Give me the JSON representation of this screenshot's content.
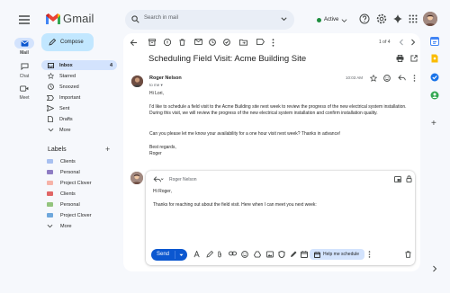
{
  "app": {
    "name": "Gmail"
  },
  "search": {
    "placeholder": "Search in mail"
  },
  "status": {
    "label": "Active"
  },
  "rail": [
    {
      "label": "Mail",
      "icon": "mail-icon"
    },
    {
      "label": "Chat",
      "icon": "chat-icon"
    },
    {
      "label": "Meet",
      "icon": "video-icon"
    }
  ],
  "compose": {
    "label": "Compose"
  },
  "nav": [
    {
      "label": "Inbox",
      "icon": "inbox-icon",
      "count": "4",
      "selected": true
    },
    {
      "label": "Starred",
      "icon": "star-icon",
      "count": ""
    },
    {
      "label": "Snoozed",
      "icon": "clock-icon",
      "count": ""
    },
    {
      "label": "Important",
      "icon": "label-important-icon",
      "count": ""
    },
    {
      "label": "Sent",
      "icon": "send-icon",
      "count": ""
    },
    {
      "label": "Drafts",
      "icon": "draft-icon",
      "count": ""
    },
    {
      "label": "More",
      "icon": "chevron-down-icon",
      "count": ""
    }
  ],
  "labels": {
    "heading": "Labels",
    "items": [
      {
        "label": "Clients",
        "color": "#a8c0f0"
      },
      {
        "label": "Personal",
        "color": "#8e7cc3"
      },
      {
        "label": "Project Clover",
        "color": "#f6b3a8"
      },
      {
        "label": "Clients",
        "color": "#e06666"
      },
      {
        "label": "Personal",
        "color": "#93c47d"
      },
      {
        "label": "Project Clover",
        "color": "#6fa8dc"
      },
      {
        "label": "More",
        "color": ""
      }
    ]
  },
  "pager": {
    "text": "1 of 4"
  },
  "email": {
    "subject": "Scheduling Field Visit: Acme Building Site",
    "sender": "Roger Nelson",
    "to": "to me",
    "time": "10:03 AM",
    "body": [
      "Hi Lori,",
      "I'd like to schedule a field visit to the Acme Building site next week to review the progress of the new electrical system installation. During this visit, we will review the progress of the new electrical system installation and confirm installation quality.",
      "Can you please let me know your availability for a one hour visit next week? Thanks in advance!",
      "Best regards,",
      "Roger"
    ]
  },
  "reply": {
    "to": "Roger Nelson",
    "greeting": "Hi Roger,",
    "text": "Thanks for reaching out about the field visit. Here when I can meet you next week:",
    "send_label": "Send",
    "help_label": "Help me schedule"
  },
  "colors": {
    "accent": "#0b57d0",
    "compose": "#c2e7ff",
    "selected": "#d3e3fd",
    "active": "#1e8e3e"
  }
}
